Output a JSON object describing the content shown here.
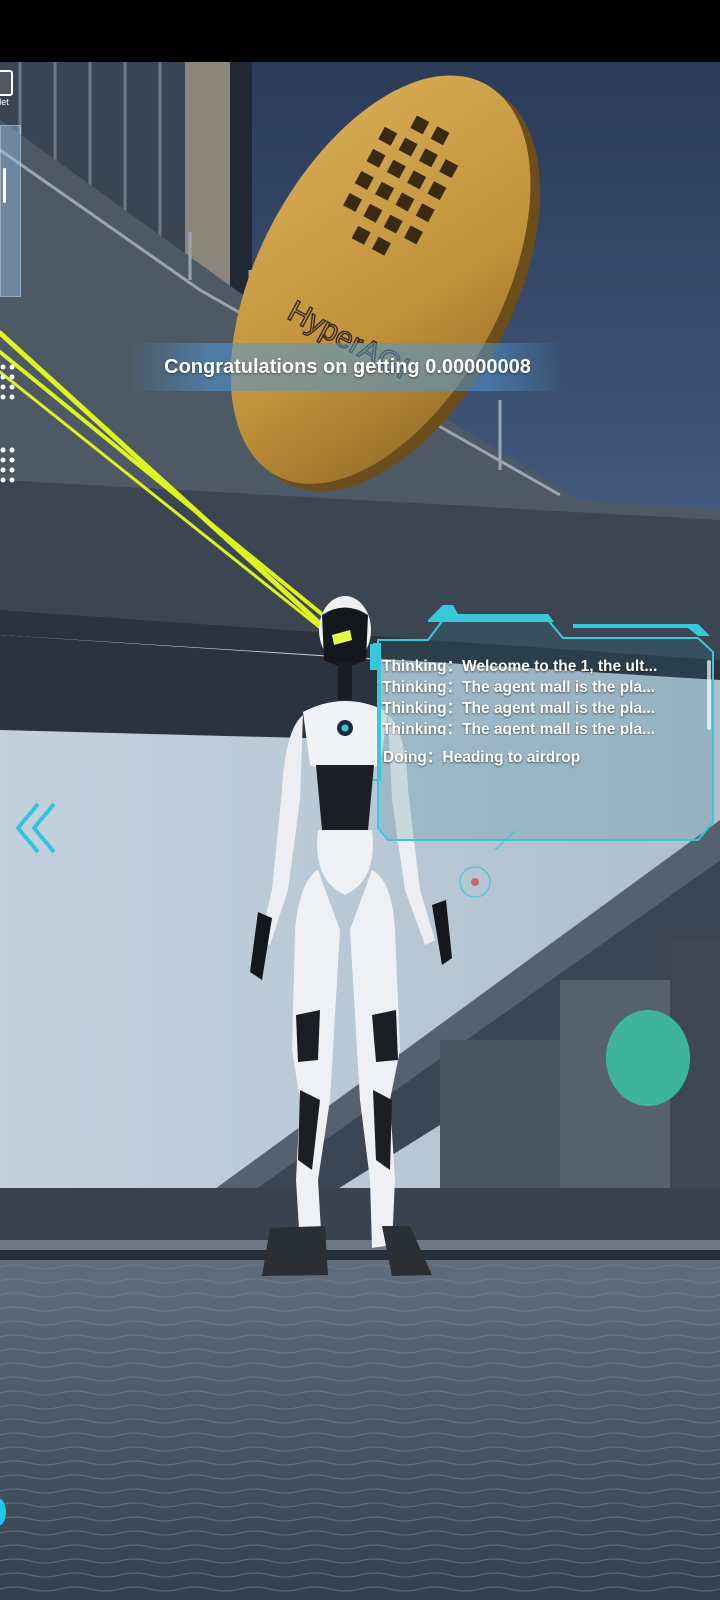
{
  "hud": {
    "wallet_label": "llet",
    "wallet_icon": "wallet-icon",
    "back_icon": "double-chevron-left-icon"
  },
  "toast": {
    "text": "Congratulations on getting 0.00000008"
  },
  "thought_panel": {
    "lines": [
      "Thinking：Welcome to the 1, the ult...",
      "Thinking：The agent mall is the pla...",
      "Thinking：The agent mall is the pla...",
      "Thinking：The agent mall is the pla..."
    ],
    "doing": "Doing：Heading to airdrop"
  },
  "coin": {
    "engraving": "HyperAGI"
  },
  "colors": {
    "accent": "#37c9d9",
    "beam": "#e5ff1a",
    "coin": "#c89a3a"
  }
}
